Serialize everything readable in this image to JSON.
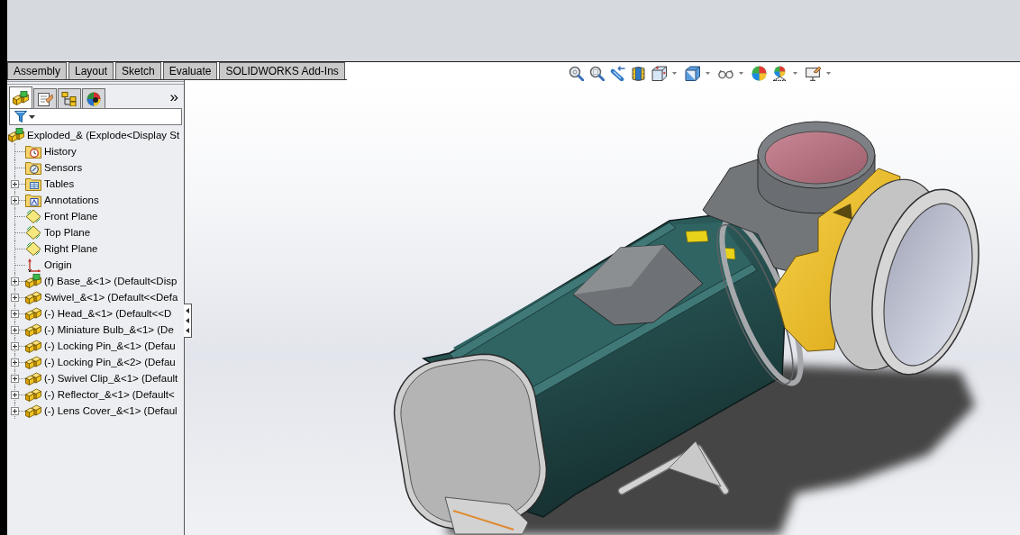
{
  "ribbon_tabs": [
    {
      "label": "Assembly",
      "selected": false
    },
    {
      "label": "Layout",
      "selected": false
    },
    {
      "label": "Sketch",
      "selected": false
    },
    {
      "label": "Evaluate",
      "selected": false
    },
    {
      "label": "SOLIDWORKS Add-Ins",
      "selected": false
    }
  ],
  "view_toolbar": [
    {
      "kind": "zoom-fit",
      "dropdown": false
    },
    {
      "kind": "zoom-area",
      "dropdown": false
    },
    {
      "kind": "previous-view",
      "dropdown": false
    },
    {
      "kind": "section-view",
      "dropdown": false
    },
    {
      "kind": "view-orientation",
      "dropdown": true
    },
    {
      "kind": "display-style",
      "dropdown": true
    },
    {
      "kind": "hide-show",
      "dropdown": true
    },
    {
      "kind": "appearance",
      "dropdown": false
    },
    {
      "kind": "scene",
      "dropdown": true
    },
    {
      "kind": "view-settings",
      "dropdown": true
    }
  ],
  "feature_manager": {
    "tabs": [
      {
        "kind": "tree",
        "selected": true
      },
      {
        "kind": "properties",
        "selected": false
      },
      {
        "kind": "configurations",
        "selected": false
      },
      {
        "kind": "display",
        "selected": false
      }
    ],
    "more": "»",
    "tree": {
      "label": "Exploded_& (Explode<Display St",
      "kind": "assembly",
      "children": [
        {
          "label": "History",
          "kind": "history"
        },
        {
          "label": "Sensors",
          "kind": "sensors"
        },
        {
          "label": "Tables",
          "kind": "tables",
          "expanded": false
        },
        {
          "label": "Annotations",
          "kind": "annotations",
          "expanded": false
        },
        {
          "label": "Front Plane",
          "kind": "plane"
        },
        {
          "label": "Top Plane",
          "kind": "plane"
        },
        {
          "label": "Right Plane",
          "kind": "plane"
        },
        {
          "label": "Origin",
          "kind": "origin"
        },
        {
          "label": "(f) Base_&<1> (Default<Disp",
          "kind": "assembly",
          "expanded": false
        },
        {
          "label": "Swivel_&<1> (Default<<Defa",
          "kind": "part",
          "expanded": false
        },
        {
          "label": "(-) Head_&<1> (Default<<D",
          "kind": "part",
          "expanded": false
        },
        {
          "label": "(-) Miniature Bulb_&<1> (De",
          "kind": "part",
          "expanded": false
        },
        {
          "label": "(-) Locking Pin_&<1> (Defau",
          "kind": "part",
          "expanded": false
        },
        {
          "label": "(-) Locking Pin_&<2> (Defau",
          "kind": "part",
          "expanded": false
        },
        {
          "label": "(-) Swivel Clip_&<1> (Default",
          "kind": "part",
          "expanded": false
        },
        {
          "label": "(-) Reflector_&<1> (Default<",
          "kind": "part",
          "expanded": false
        },
        {
          "label": "(-) Lens Cover_&<1> (Defaul",
          "kind": "part",
          "expanded": false
        }
      ]
    }
  }
}
